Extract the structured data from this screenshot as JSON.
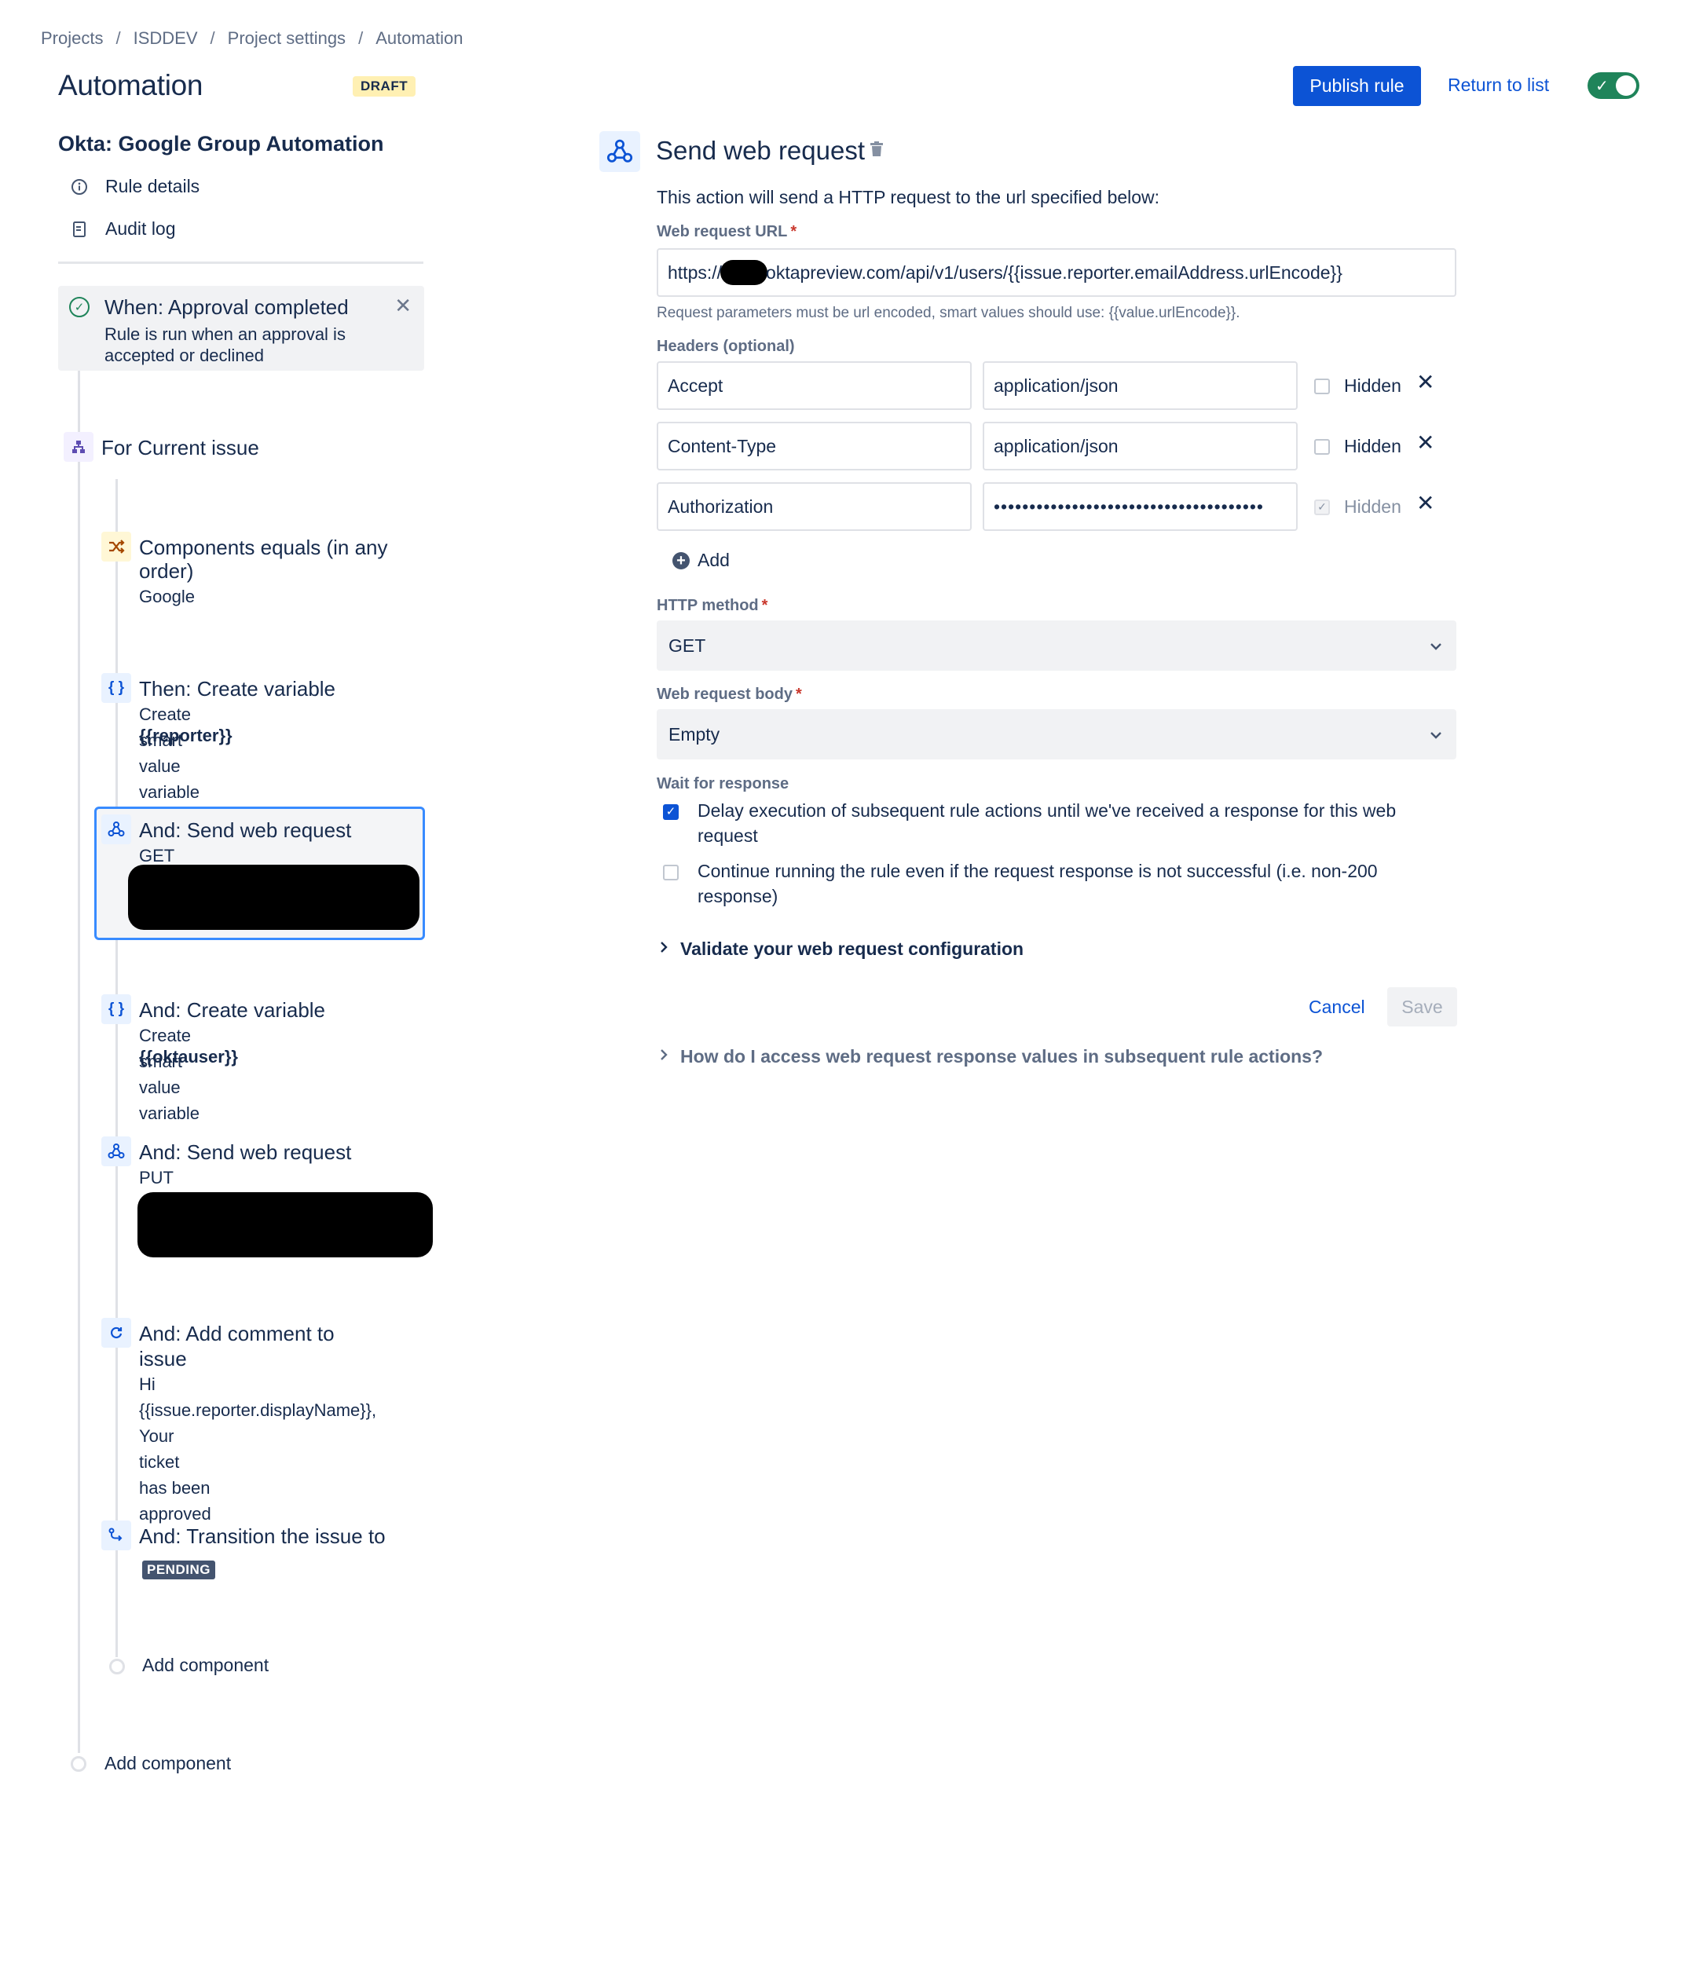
{
  "breadcrumb": [
    "Projects",
    "ISDDEV",
    "Project settings",
    "Automation"
  ],
  "page": {
    "title": "Automation",
    "status_badge": "DRAFT",
    "publish_label": "Publish rule",
    "return_label": "Return to list",
    "toggle_enabled": true
  },
  "sidebar": {
    "rule_name": "Okta: Google Group Automation",
    "rule_details": "Rule details",
    "audit_log": "Audit log",
    "trigger": {
      "title": "When: Approval completed",
      "description": "Rule is run when an approval is accepted or declined"
    },
    "components": [
      {
        "title": "For Current issue"
      },
      {
        "title": "Components equals (in any",
        "title2": "order)",
        "sub": "Google"
      },
      {
        "title": "Then: Create variable",
        "sub": "Create smart value variable",
        "sub_bold": "{{reporter}}"
      },
      {
        "title": "And: Send web request",
        "sub": "GET"
      },
      {
        "title": "And: Create variable",
        "sub": "Create smart value variable",
        "sub_bold": "{{oktauser}}"
      },
      {
        "title": "And: Send web request",
        "sub": "PUT"
      },
      {
        "title": "And: Add comment to",
        "title2": "issue",
        "lines": [
          "Hi",
          "{{issue.reporter.displayName}},",
          "Your ticket has been approved"
        ]
      },
      {
        "title": "And: Transition the issue to",
        "badge": "PENDING"
      }
    ],
    "add_component_inner": "Add component",
    "add_component_outer": "Add component"
  },
  "panel": {
    "title": "Send web request",
    "description": "This action will send a HTTP request to the url specified below:",
    "url_label": "Web request URL",
    "url_prefix": "https://",
    "url_suffix": "oktapreview.com/api/v1/users/{{issue.reporter.emailAddress.urlEncode}}",
    "url_hint": "Request parameters must be url encoded, smart values should use: {{value.urlEncode}}.",
    "headers_label": "Headers (optional)",
    "headers": [
      {
        "name": "Accept",
        "value": "application/json",
        "hidden_label": "Hidden",
        "hidden": false
      },
      {
        "name": "Content-Type",
        "value": "application/json",
        "hidden_label": "Hidden",
        "hidden": false
      },
      {
        "name": "Authorization",
        "value": "••••••••••••••••••••••••••••••••••••••",
        "hidden_label": "Hidden",
        "hidden": true
      }
    ],
    "add_label": "Add",
    "method_label": "HTTP method",
    "method_value": "GET",
    "body_label": "Web request body",
    "body_value": "Empty",
    "wait_label": "Wait for response",
    "delay_option": "Delay execution of subsequent rule actions until we've received a response for this web request",
    "delay_checked": true,
    "continue_option": "Continue running the rule even if the request response is not successful (i.e. non-200 response)",
    "continue_checked": false,
    "validate_label": "Validate your web request configuration",
    "cancel_label": "Cancel",
    "save_label": "Save",
    "help_label": "How do I access web request response values in subsequent rule actions?"
  },
  "colors": {
    "primary": "#0c53d5",
    "toggle_on": "#1f845a",
    "draft_badge": "#fff0b3",
    "selected_border": "#388bff"
  }
}
